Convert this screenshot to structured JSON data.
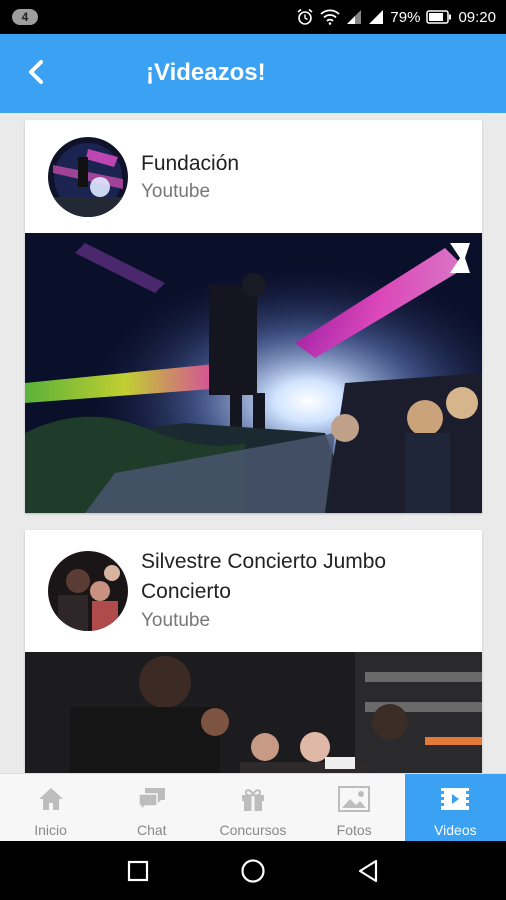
{
  "status_bar": {
    "notification_count": "4",
    "battery_percent": "79%",
    "time": "09:20",
    "icons": [
      "alarm-icon",
      "wifi-icon",
      "signal-icon",
      "signal-icon",
      "battery-icon"
    ]
  },
  "app_bar": {
    "title": "¡Videazos!",
    "back_icon": "chevron-left-icon",
    "color": "#3aa1f3"
  },
  "videos": [
    {
      "title": "Fundación",
      "source": "Youtube"
    },
    {
      "title": "Silvestre Concierto Jumbo Concierto",
      "source": "Youtube"
    }
  ],
  "bottom_nav": {
    "items": [
      {
        "label": "Inicio",
        "icon": "home-icon",
        "active": false
      },
      {
        "label": "Chat",
        "icon": "chat-icon",
        "active": false
      },
      {
        "label": "Concursos",
        "icon": "gift-icon",
        "active": false
      },
      {
        "label": "Fotos",
        "icon": "image-icon",
        "active": false
      },
      {
        "label": "Videos",
        "icon": "video-icon",
        "active": true
      }
    ],
    "active_color": "#3aa1f3"
  },
  "system_nav": {
    "icons": [
      "recents-square-icon",
      "home-circle-icon",
      "back-triangle-icon"
    ]
  }
}
